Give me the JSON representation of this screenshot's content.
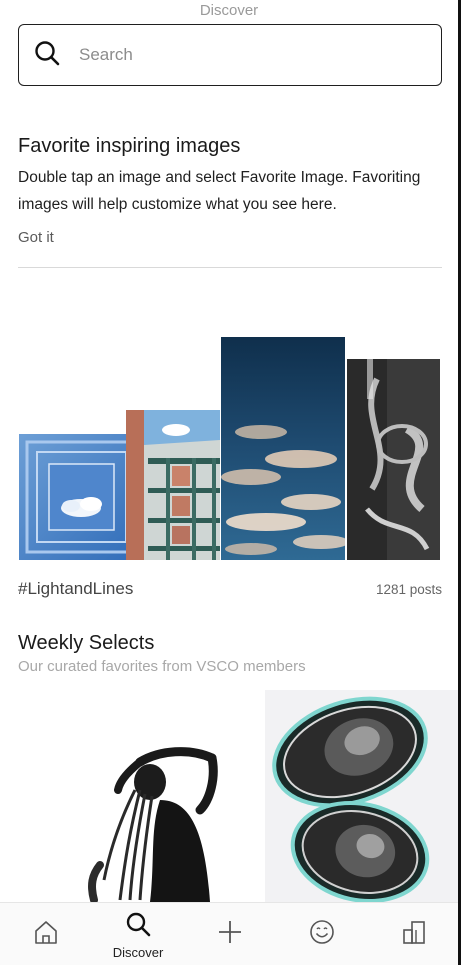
{
  "header": {
    "title": "Discover"
  },
  "search": {
    "placeholder": "Search"
  },
  "favorites_tip": {
    "title": "Favorite inspiring images",
    "body": "Double tap an image and select Favorite Image. Favoriting images will help customize what you see here.",
    "dismiss_label": "Got it"
  },
  "collection": {
    "tag": "#LightandLines",
    "count": "1281 posts"
  },
  "weekly": {
    "title": "Weekly Selects",
    "subtitle": "Our curated favorites from VSCO members"
  },
  "tabbar": {
    "active": "discover",
    "items": [
      {
        "id": "home",
        "icon": "home-icon",
        "label": ""
      },
      {
        "id": "discover",
        "icon": "search-icon",
        "label": "Discover"
      },
      {
        "id": "create",
        "icon": "plus-icon",
        "label": ""
      },
      {
        "id": "community",
        "icon": "smiley-icon",
        "label": ""
      },
      {
        "id": "studio",
        "icon": "studio-icon",
        "label": ""
      }
    ]
  },
  "colors": {
    "accent": "#1a1a1a",
    "muted": "#a8a8a8",
    "divider": "#d9d9d9"
  }
}
